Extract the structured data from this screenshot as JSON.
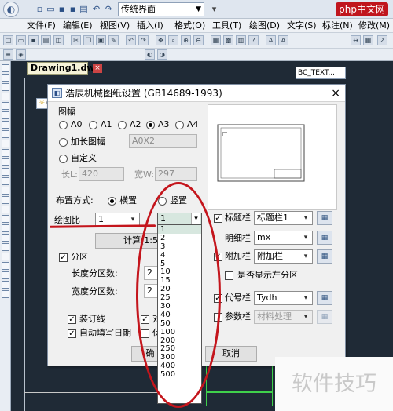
{
  "app": {
    "workspace": "传统界面",
    "site_logo": "php中文网",
    "text_style": "BC_TEXT...",
    "layer": "0"
  },
  "menubar": [
    "文件(F)",
    "编辑(E)",
    "视图(V)",
    "插入(I)",
    "格式(O)",
    "工具(T)",
    "绘图(D)",
    "文字(S)",
    "标注(N)",
    "修改(M)"
  ],
  "document_tab": {
    "label": "Drawing1.dwg"
  },
  "dialog": {
    "title": "浩辰机械图纸设置 (GB14689-1993)",
    "paper_group_label": "图幅",
    "paper_sizes": [
      "A0",
      "A1",
      "A2",
      "A3",
      "A4"
    ],
    "paper_selected": "A3",
    "extended_label": "加长图幅",
    "extended_value": "A0X2",
    "custom_label": "自定义",
    "length_label": "长L:",
    "length_value": "420",
    "width_label": "宽W:",
    "width_value": "297",
    "layout_label": "布置方式:",
    "layout_options": [
      "横置",
      "竖置"
    ],
    "layout_selected": "横置",
    "scale_label": "绘图比",
    "scale_left_value": "1",
    "scale_right_value": "1",
    "calc_button": "计算(1:5",
    "zone_label": "分区",
    "zone_length_label": "长度分区数:",
    "zone_length_value": "2",
    "zone_width_label": "宽度分区数:",
    "zone_width_value": "2",
    "binding_label": "装订线",
    "auto_date_label": "自动填写日期",
    "hidden_a": "对",
    "hidden_b": "保",
    "ok_label": "确",
    "cancel_label": "取消",
    "title_block_label": "标题栏",
    "title_block_value": "标题栏1",
    "detail_block_label": "明细栏",
    "detail_block_value": "mx",
    "attach_block_label": "附加栏",
    "attach_block_value": "附加栏",
    "show_left_zone_label": "是否显示左分区",
    "code_block_label": "代号栏",
    "code_block_value": "Tydh",
    "param_block_label": "参数栏",
    "param_block_value": "材料处理",
    "scale_options": [
      "1",
      "2",
      "3",
      "4",
      "5",
      "10",
      "15",
      "20",
      "25",
      "30",
      "40",
      "50",
      "100",
      "200",
      "250",
      "300",
      "400",
      "500"
    ]
  },
  "watermark": "软件技巧"
}
